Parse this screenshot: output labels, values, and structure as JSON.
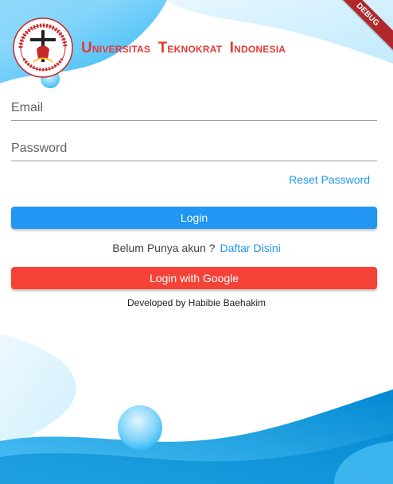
{
  "header": {
    "brand_words": [
      {
        "cap": "U",
        "rest": "NIVERSITAS"
      },
      {
        "cap": "T",
        "rest": "EKNOKRAT"
      },
      {
        "cap": "I",
        "rest": "NDONESIA"
      }
    ],
    "logo_text": "Universitas Teknokrat Indonesia"
  },
  "form": {
    "email_placeholder": "Email",
    "password_placeholder": "Password",
    "reset_label": "Reset Password",
    "login_label": "Login",
    "signup_prompt": "Belum Punya akun ?",
    "signup_link": "Daftar Disini",
    "google_label": "Login with Google"
  },
  "footer": {
    "credit": "Developed by Habibie Baehakim"
  },
  "debug_banner": "DEBUG",
  "colors": {
    "primary": "#2196f3",
    "danger": "#f44336",
    "brand_red": "#e53935",
    "wave": "#29b6f6"
  }
}
